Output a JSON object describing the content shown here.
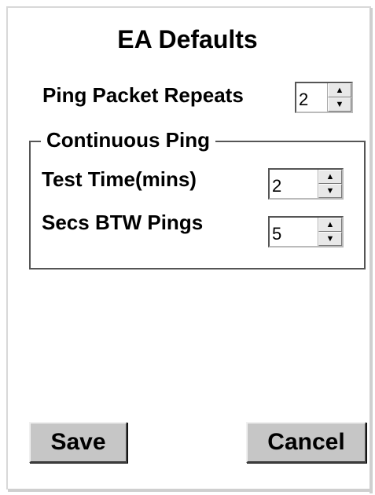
{
  "dialog": {
    "title": "EA Defaults",
    "ping_packet_repeats": {
      "label": "Ping Packet Repeats",
      "value": "2"
    },
    "continuous_ping": {
      "legend": "Continuous Ping",
      "test_time": {
        "label": "Test Time(mins)",
        "value": "2"
      },
      "secs_btw_pings": {
        "label": "Secs BTW Pings",
        "value": "5"
      }
    },
    "buttons": {
      "save": "Save",
      "cancel": "Cancel"
    }
  },
  "icons": {
    "spin_up": "arrow-up-icon",
    "spin_down": "arrow-down-icon"
  }
}
